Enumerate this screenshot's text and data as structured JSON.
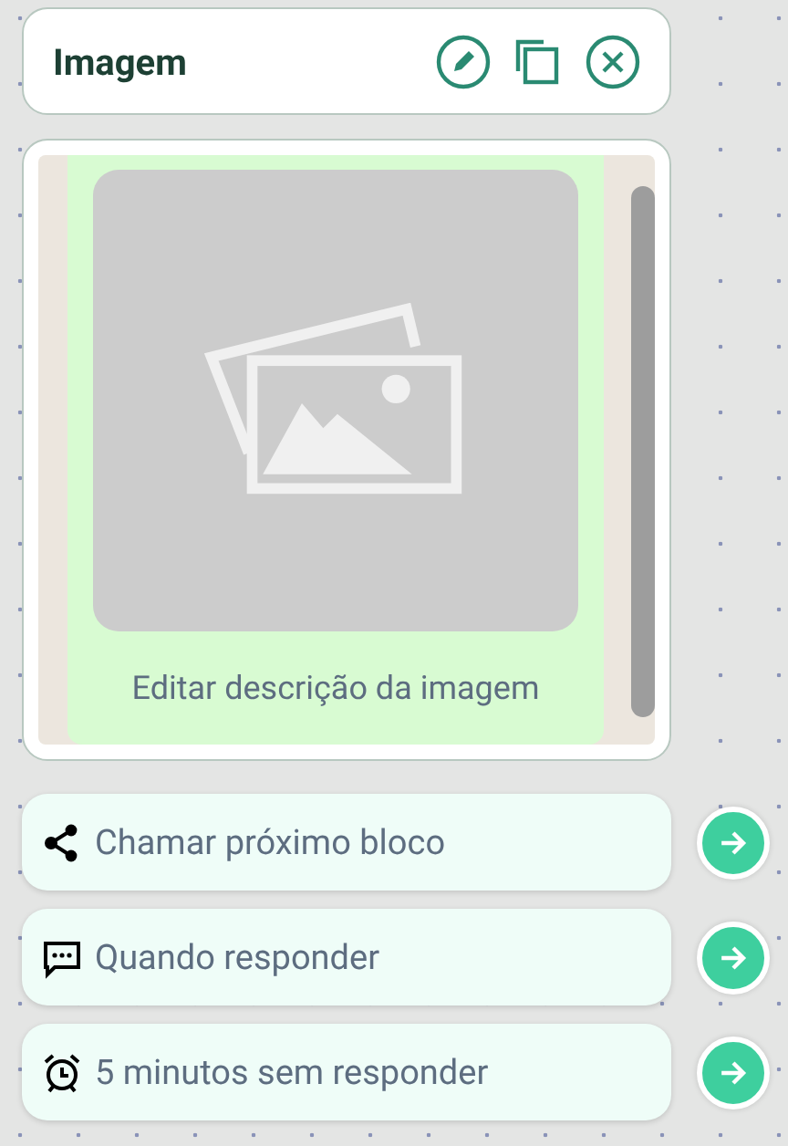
{
  "header": {
    "title": "Imagem"
  },
  "message": {
    "kind": "picture",
    "caption": "Editar descrição da imagem"
  },
  "options": [
    {
      "kind": "share",
      "label": "Chamar próximo bloco"
    },
    {
      "kind": "message",
      "label": "Quando responder"
    },
    {
      "kind": "alarm",
      "label": "5 minutos sem responder"
    }
  ]
}
